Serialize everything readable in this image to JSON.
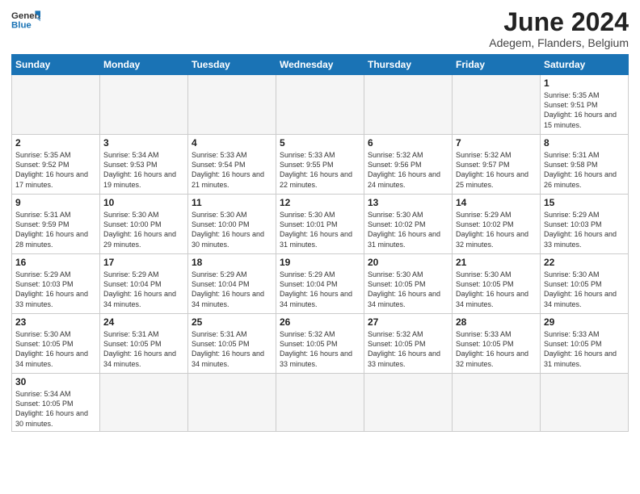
{
  "logo": {
    "text_general": "General",
    "text_blue": "Blue"
  },
  "header": {
    "month": "June 2024",
    "location": "Adegem, Flanders, Belgium"
  },
  "weekdays": [
    "Sunday",
    "Monday",
    "Tuesday",
    "Wednesday",
    "Thursday",
    "Friday",
    "Saturday"
  ],
  "weeks": [
    [
      {
        "day": "",
        "info": ""
      },
      {
        "day": "",
        "info": ""
      },
      {
        "day": "",
        "info": ""
      },
      {
        "day": "",
        "info": ""
      },
      {
        "day": "",
        "info": ""
      },
      {
        "day": "",
        "info": ""
      },
      {
        "day": "1",
        "info": "Sunrise: 5:35 AM\nSunset: 9:51 PM\nDaylight: 16 hours\nand 15 minutes."
      }
    ],
    [
      {
        "day": "2",
        "info": "Sunrise: 5:35 AM\nSunset: 9:52 PM\nDaylight: 16 hours\nand 17 minutes."
      },
      {
        "day": "3",
        "info": "Sunrise: 5:34 AM\nSunset: 9:53 PM\nDaylight: 16 hours\nand 19 minutes."
      },
      {
        "day": "4",
        "info": "Sunrise: 5:33 AM\nSunset: 9:54 PM\nDaylight: 16 hours\nand 21 minutes."
      },
      {
        "day": "5",
        "info": "Sunrise: 5:33 AM\nSunset: 9:55 PM\nDaylight: 16 hours\nand 22 minutes."
      },
      {
        "day": "6",
        "info": "Sunrise: 5:32 AM\nSunset: 9:56 PM\nDaylight: 16 hours\nand 24 minutes."
      },
      {
        "day": "7",
        "info": "Sunrise: 5:32 AM\nSunset: 9:57 PM\nDaylight: 16 hours\nand 25 minutes."
      },
      {
        "day": "8",
        "info": "Sunrise: 5:31 AM\nSunset: 9:58 PM\nDaylight: 16 hours\nand 26 minutes."
      }
    ],
    [
      {
        "day": "9",
        "info": "Sunrise: 5:31 AM\nSunset: 9:59 PM\nDaylight: 16 hours\nand 28 minutes."
      },
      {
        "day": "10",
        "info": "Sunrise: 5:30 AM\nSunset: 10:00 PM\nDaylight: 16 hours\nand 29 minutes."
      },
      {
        "day": "11",
        "info": "Sunrise: 5:30 AM\nSunset: 10:00 PM\nDaylight: 16 hours\nand 30 minutes."
      },
      {
        "day": "12",
        "info": "Sunrise: 5:30 AM\nSunset: 10:01 PM\nDaylight: 16 hours\nand 31 minutes."
      },
      {
        "day": "13",
        "info": "Sunrise: 5:30 AM\nSunset: 10:02 PM\nDaylight: 16 hours\nand 31 minutes."
      },
      {
        "day": "14",
        "info": "Sunrise: 5:29 AM\nSunset: 10:02 PM\nDaylight: 16 hours\nand 32 minutes."
      },
      {
        "day": "15",
        "info": "Sunrise: 5:29 AM\nSunset: 10:03 PM\nDaylight: 16 hours\nand 33 minutes."
      }
    ],
    [
      {
        "day": "16",
        "info": "Sunrise: 5:29 AM\nSunset: 10:03 PM\nDaylight: 16 hours\nand 33 minutes."
      },
      {
        "day": "17",
        "info": "Sunrise: 5:29 AM\nSunset: 10:04 PM\nDaylight: 16 hours\nand 34 minutes."
      },
      {
        "day": "18",
        "info": "Sunrise: 5:29 AM\nSunset: 10:04 PM\nDaylight: 16 hours\nand 34 minutes."
      },
      {
        "day": "19",
        "info": "Sunrise: 5:29 AM\nSunset: 10:04 PM\nDaylight: 16 hours\nand 34 minutes."
      },
      {
        "day": "20",
        "info": "Sunrise: 5:30 AM\nSunset: 10:05 PM\nDaylight: 16 hours\nand 34 minutes."
      },
      {
        "day": "21",
        "info": "Sunrise: 5:30 AM\nSunset: 10:05 PM\nDaylight: 16 hours\nand 34 minutes."
      },
      {
        "day": "22",
        "info": "Sunrise: 5:30 AM\nSunset: 10:05 PM\nDaylight: 16 hours\nand 34 minutes."
      }
    ],
    [
      {
        "day": "23",
        "info": "Sunrise: 5:30 AM\nSunset: 10:05 PM\nDaylight: 16 hours\nand 34 minutes."
      },
      {
        "day": "24",
        "info": "Sunrise: 5:31 AM\nSunset: 10:05 PM\nDaylight: 16 hours\nand 34 minutes."
      },
      {
        "day": "25",
        "info": "Sunrise: 5:31 AM\nSunset: 10:05 PM\nDaylight: 16 hours\nand 34 minutes."
      },
      {
        "day": "26",
        "info": "Sunrise: 5:32 AM\nSunset: 10:05 PM\nDaylight: 16 hours\nand 33 minutes."
      },
      {
        "day": "27",
        "info": "Sunrise: 5:32 AM\nSunset: 10:05 PM\nDaylight: 16 hours\nand 33 minutes."
      },
      {
        "day": "28",
        "info": "Sunrise: 5:33 AM\nSunset: 10:05 PM\nDaylight: 16 hours\nand 32 minutes."
      },
      {
        "day": "29",
        "info": "Sunrise: 5:33 AM\nSunset: 10:05 PM\nDaylight: 16 hours\nand 31 minutes."
      }
    ],
    [
      {
        "day": "30",
        "info": "Sunrise: 5:34 AM\nSunset: 10:05 PM\nDaylight: 16 hours\nand 30 minutes."
      },
      {
        "day": "",
        "info": ""
      },
      {
        "day": "",
        "info": ""
      },
      {
        "day": "",
        "info": ""
      },
      {
        "day": "",
        "info": ""
      },
      {
        "day": "",
        "info": ""
      },
      {
        "day": "",
        "info": ""
      }
    ]
  ]
}
